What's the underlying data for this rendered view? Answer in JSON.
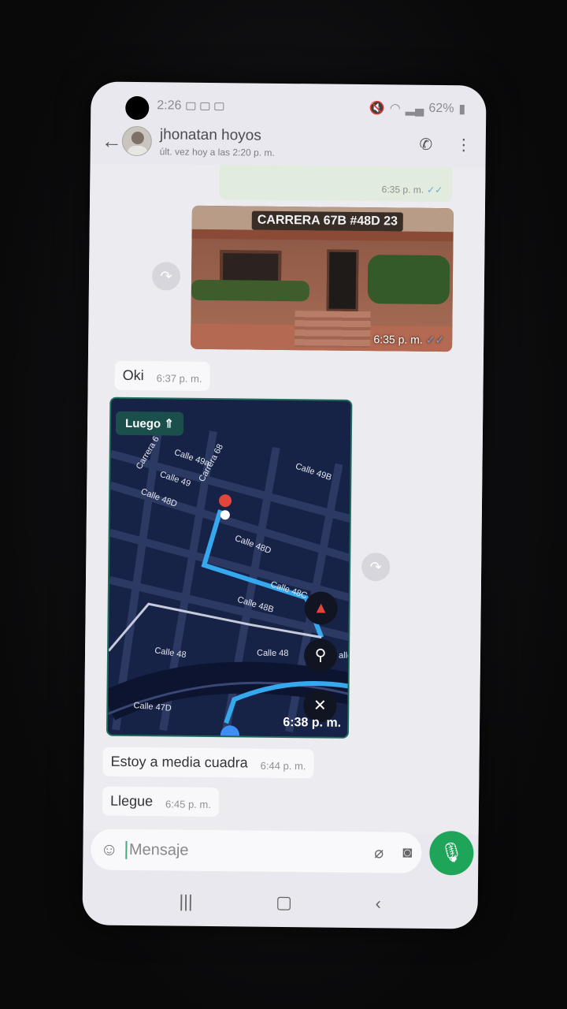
{
  "status_bar": {
    "time": "2:26",
    "battery": "62%"
  },
  "header": {
    "contact_name": "jhonatan hoyos",
    "last_seen": "últ. vez hoy a las 2:20 p. m."
  },
  "messages": [
    {
      "type": "outgoing-cropped",
      "time": "6:35 p. m."
    },
    {
      "type": "outgoing-photo",
      "caption_sign": "CARRERA 67B #48D 23",
      "time": "6:35 p. m."
    },
    {
      "type": "incoming-text",
      "text": "Oki",
      "time": "6:37 p. m."
    },
    {
      "type": "incoming-map",
      "time": "6:38 p. m.",
      "banner": "Luego",
      "labels": [
        "Carrera 6",
        "Calle 49a",
        "Carrera 68",
        "Calle 49",
        "Calle 48D",
        "Calle 49B",
        "Calle 48D",
        "Calle 48C",
        "Calle 48B",
        "Calle 48",
        "Calle 48",
        "Calle 47D",
        "alle"
      ]
    },
    {
      "type": "incoming-text",
      "text": "Estoy a media cuadra",
      "time": "6:44 p. m."
    },
    {
      "type": "incoming-text",
      "text": "Llegue",
      "time": "6:45 p. m."
    }
  ],
  "composer": {
    "placeholder": "Mensaje"
  },
  "icons": {
    "back": "arrow-left-icon",
    "call": "add-call-icon",
    "menu": "more-vertical-icon",
    "emoji": "emoji-icon",
    "attach": "paperclip-icon",
    "camera": "camera-icon",
    "mic": "microphone-icon",
    "forward": "forward-icon"
  },
  "colors": {
    "send_green": "#1fa55a",
    "read_tick_blue": "#6fa6d6",
    "map_route_blue": "#4fc3f7"
  }
}
